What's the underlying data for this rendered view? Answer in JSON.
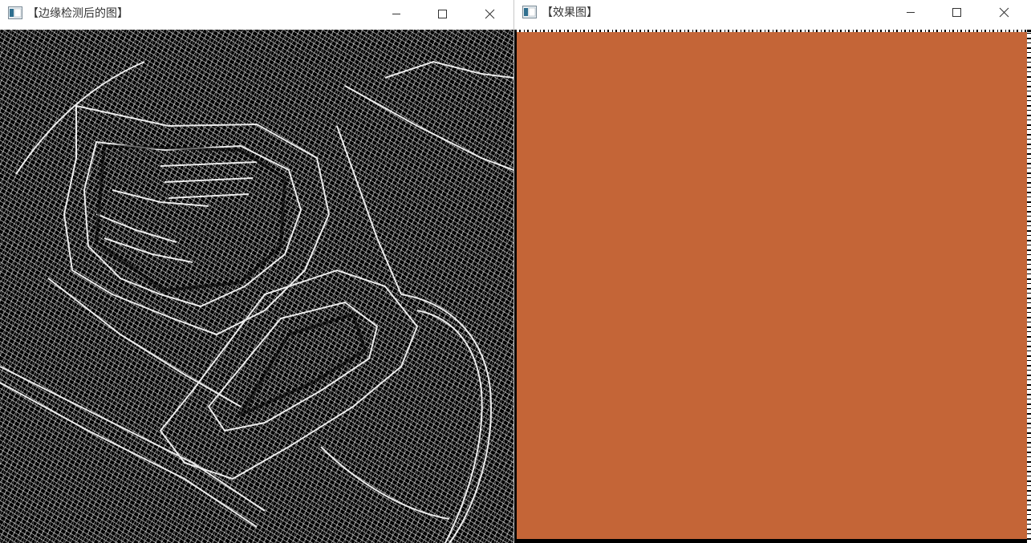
{
  "windows": [
    {
      "title": "【边缘检测后的图】",
      "icon": "opencv-window-icon",
      "controls": [
        "minimize-icon",
        "maximize-icon",
        "close-icon"
      ]
    },
    {
      "title": "【效果图】",
      "icon": "opencv-window-icon",
      "controls": [
        "minimize-icon",
        "maximize-icon",
        "close-icon"
      ],
      "fill_color": "#c46537"
    }
  ],
  "colors": {
    "edge_line": "#ffffff",
    "edge_background": "#000000",
    "effect_fill": "#c46537"
  }
}
